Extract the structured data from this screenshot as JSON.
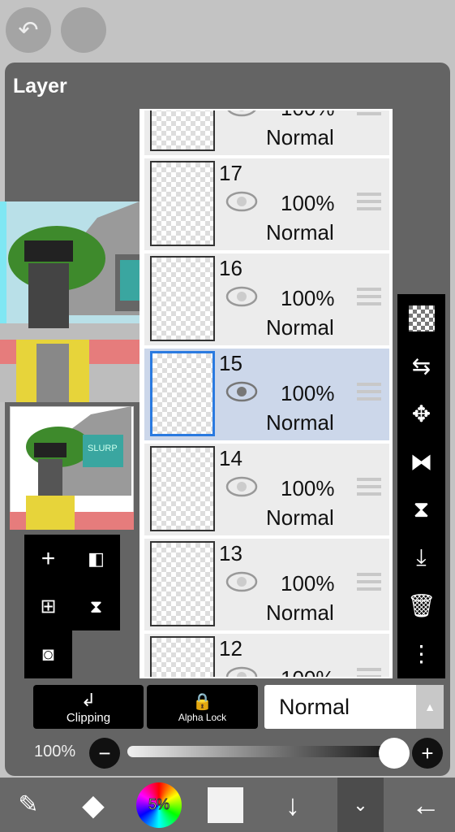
{
  "top": {
    "undo_icon": "undo-icon",
    "redo_icon": "redo-icon"
  },
  "panel": {
    "title": "Layer"
  },
  "layers": [
    {
      "number": "",
      "opacity": "100%",
      "mode": "Normal",
      "visible": true,
      "selected": false
    },
    {
      "number": "17",
      "opacity": "100%",
      "mode": "Normal",
      "visible": true,
      "selected": false
    },
    {
      "number": "16",
      "opacity": "100%",
      "mode": "Normal",
      "visible": true,
      "selected": false
    },
    {
      "number": "15",
      "opacity": "100%",
      "mode": "Normal",
      "visible": true,
      "selected": true
    },
    {
      "number": "14",
      "opacity": "100%",
      "mode": "Normal",
      "visible": true,
      "selected": false
    },
    {
      "number": "13",
      "opacity": "100%",
      "mode": "Normal",
      "visible": true,
      "selected": false
    },
    {
      "number": "12",
      "opacity": "100%",
      "mode": "Normal",
      "visible": true,
      "selected": false
    }
  ],
  "canvas_preview": {
    "sign_text": "SLURP"
  },
  "controls": {
    "clipping": "Clipping",
    "alpha_lock": "Alpha Lock",
    "blend_mode": "Normal",
    "opacity": "100%",
    "opacity_value": 100
  },
  "bottom": {
    "color_percent": "5%"
  },
  "colors": {
    "panel": "#646464",
    "selected_row": "#ccd7ea",
    "selected_border": "#2a7ae0"
  }
}
